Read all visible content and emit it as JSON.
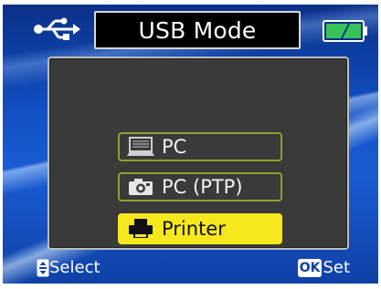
{
  "header": {
    "title": "USB Mode",
    "usb_icon": "usb-icon",
    "battery_icon": "battery-icon"
  },
  "options": [
    {
      "label": "PC",
      "icon": "laptop-icon",
      "selected": false
    },
    {
      "label": "PC (PTP)",
      "icon": "camera-ptp-icon",
      "selected": false
    },
    {
      "label": "Printer",
      "icon": "printer-icon",
      "selected": true
    }
  ],
  "footer": {
    "select_label": "Select",
    "select_icon": "dpad-icon",
    "ok_badge": "OK",
    "set_label": "Set"
  },
  "colors": {
    "background": "#0d3fa8",
    "panel": "#3a3a3a",
    "option_border": "#8ca22c",
    "selected_fill": "#f7e81e",
    "battery": "#38c35a"
  }
}
